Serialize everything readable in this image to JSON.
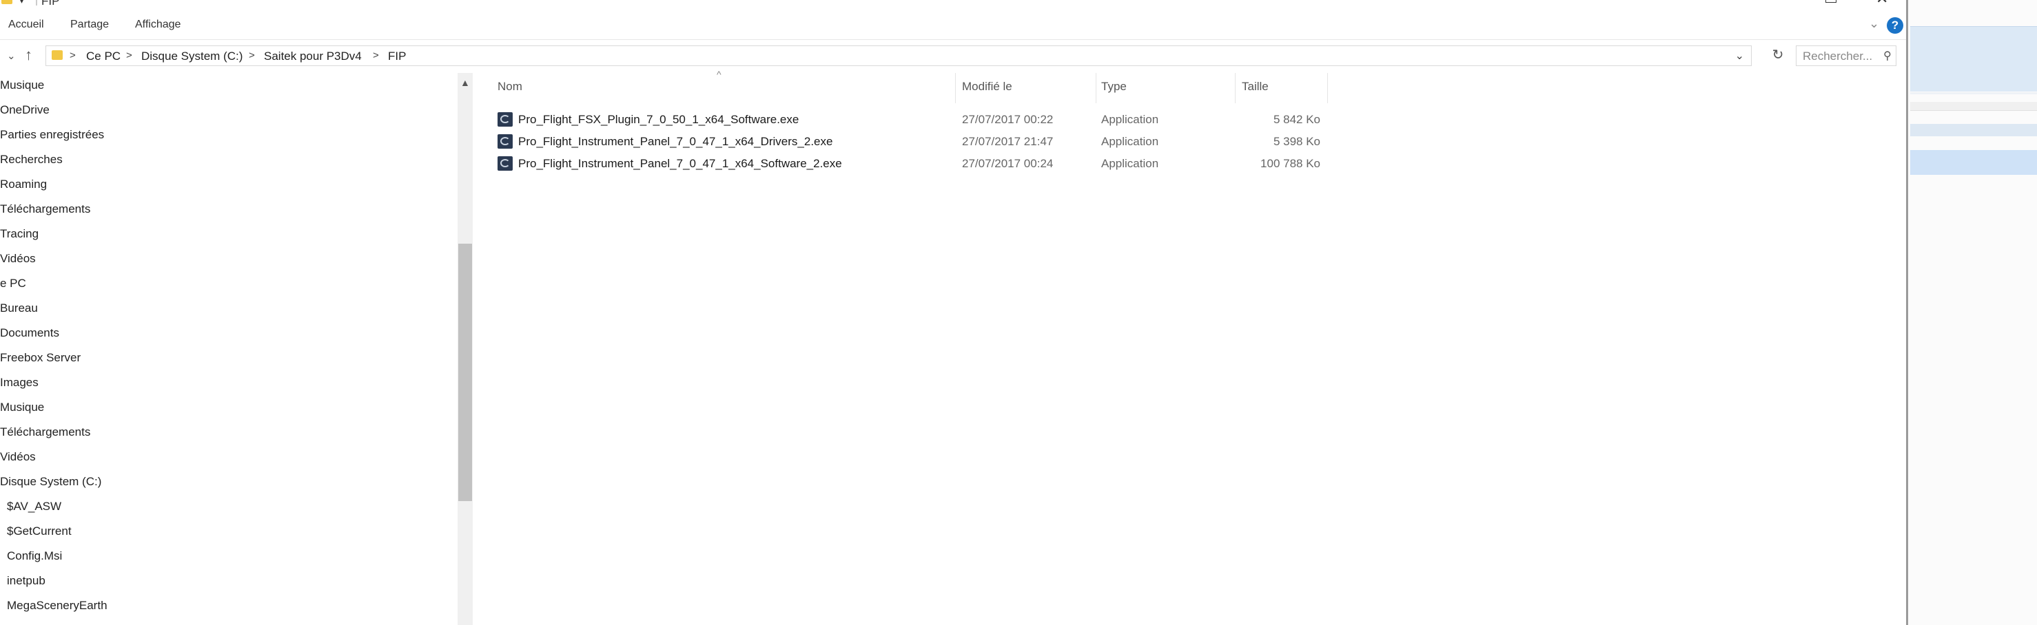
{
  "window": {
    "title": "FIP"
  },
  "ribbon": {
    "tabs": [
      "Accueil",
      "Partage",
      "Affichage"
    ],
    "help": "?"
  },
  "address": {
    "crumbs": [
      "Ce PC",
      "Disque System (C:)",
      "Saitek pour P3Dv4",
      "FIP"
    ],
    "separator": ">"
  },
  "search": {
    "placeholder": "Rechercher..."
  },
  "nav": {
    "items": [
      "Musique",
      "OneDrive",
      "Parties enregistrées",
      "Recherches",
      "Roaming",
      "Téléchargements",
      "Tracing",
      "Vidéos",
      "e PC",
      "Bureau",
      "Documents",
      "Freebox Server",
      "Images",
      "Musique",
      "Téléchargements",
      "Vidéos",
      "Disque System (C:)",
      "$AV_ASW",
      "$GetCurrent",
      "Config.Msi",
      "inetpub",
      "MegaSceneryEarth"
    ]
  },
  "columns": {
    "name": "Nom",
    "modified": "Modifié le",
    "type": "Type",
    "size": "Taille"
  },
  "files": [
    {
      "name": "Pro_Flight_FSX_Plugin_7_0_50_1_x64_Software.exe",
      "modified": "27/07/2017 00:22",
      "type": "Application",
      "size": "5 842 Ko"
    },
    {
      "name": "Pro_Flight_Instrument_Panel_7_0_47_1_x64_Drivers_2.exe",
      "modified": "27/07/2017 21:47",
      "type": "Application",
      "size": "5 398 Ko"
    },
    {
      "name": "Pro_Flight_Instrument_Panel_7_0_47_1_x64_Software_2.exe",
      "modified": "27/07/2017 00:24",
      "type": "Application",
      "size": "100 788 Ko"
    }
  ],
  "colors": {
    "accent": "#1a73c7",
    "folder": "#f2c744",
    "selection": "#cfe2f7"
  }
}
